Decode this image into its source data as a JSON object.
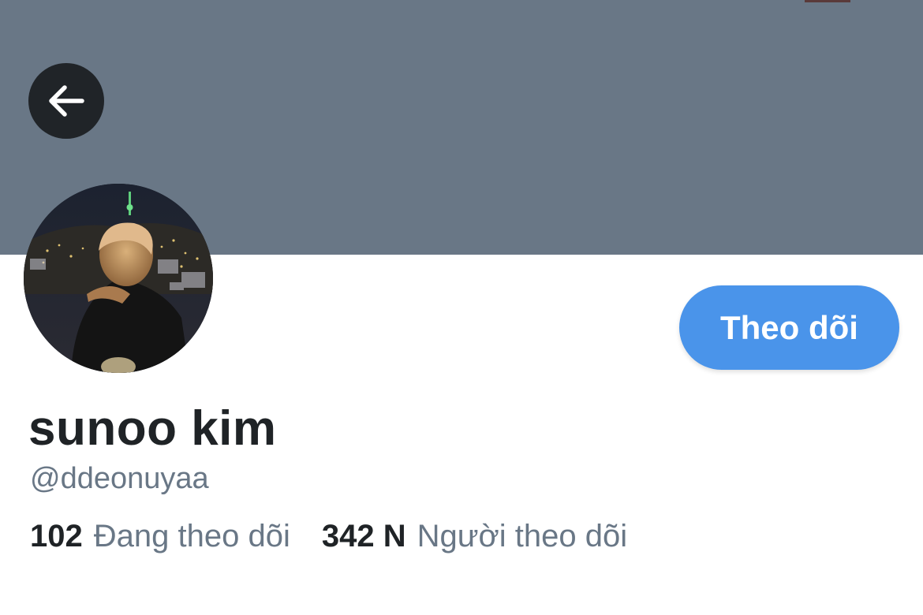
{
  "header": {
    "back_icon": "arrow-left-icon",
    "banner_color": "#697786"
  },
  "profile": {
    "avatar": "profile-photo",
    "display_name": "sunoo kim",
    "handle": "@ddeonuyaa",
    "follow_button_label": "Theo dõi",
    "follow_button_color": "#4a94ea"
  },
  "stats": {
    "following_count": "102",
    "following_label": "Đang theo dõi",
    "followers_count": "342 N",
    "followers_label": "Người theo dõi"
  }
}
